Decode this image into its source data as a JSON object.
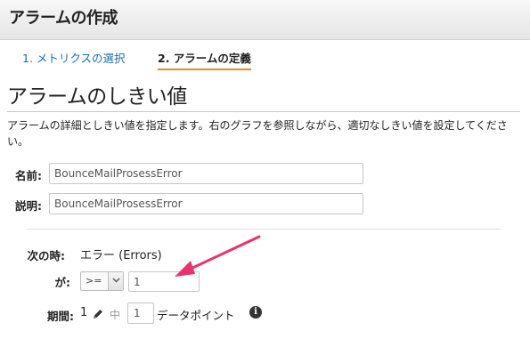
{
  "dialog": {
    "title": "アラームの作成"
  },
  "steps": [
    {
      "label": "1. メトリクスの選択"
    },
    {
      "label": "2. アラームの定義"
    }
  ],
  "section": {
    "title": "アラームのしきい値",
    "description": "アラームの詳細としきい値を指定します。右のグラフを参照しながら、適切なしきい値を設定してください。"
  },
  "form": {
    "name": {
      "label": "名前:",
      "value": "BounceMailProsessError"
    },
    "description": {
      "label": "説明:",
      "value": "BounceMailProsessError"
    }
  },
  "condition": {
    "when_label": "次の時:",
    "metric": "エラー (Errors)",
    "operator_label": "が:",
    "operator": ">=",
    "threshold": "1",
    "period_label": "期間:",
    "period": "1",
    "period_of": "中",
    "datapoints": "1",
    "datapoints_label": "データポイント",
    "info_glyph": "i"
  },
  "icons": {
    "select_arrow": "chevron-down-icon",
    "edit": "pencil-icon",
    "info": "info-icon",
    "annotation": "arrow-icon"
  },
  "colors": {
    "accent_underline": "#e38b1e",
    "link": "#1a6ca8",
    "annotation": "#e8336e"
  }
}
